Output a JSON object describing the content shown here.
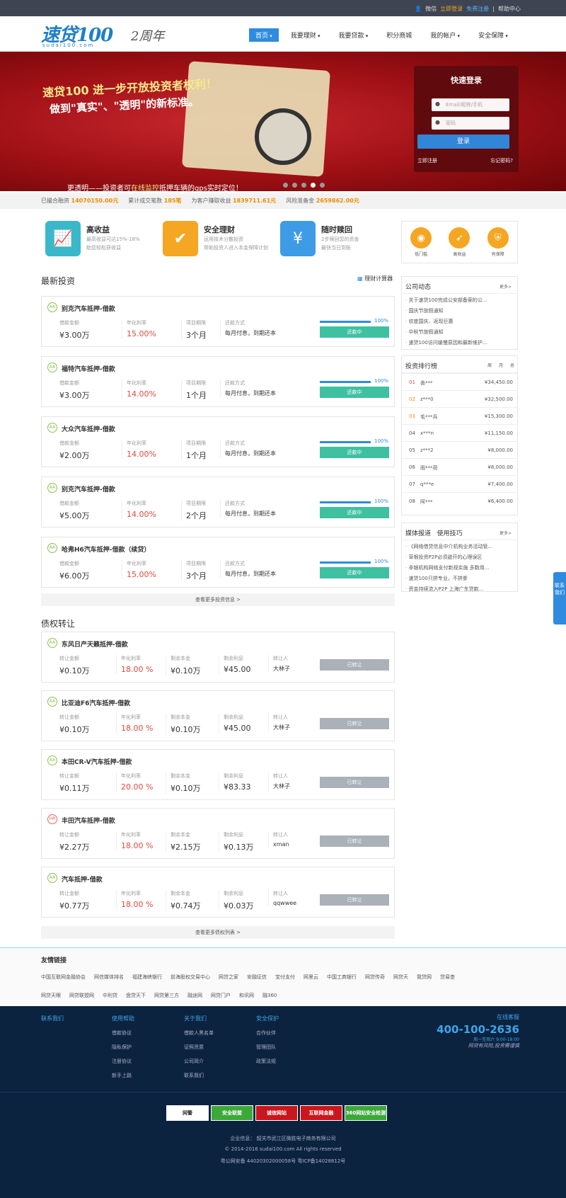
{
  "topbar": {
    "wechat": "微信",
    "login": "立即登录",
    "register": "免费注册",
    "help": "帮助中心"
  },
  "header": {
    "logo": "速贷100",
    "logo_sub": "sudai100.com",
    "anniversary": "2周年"
  },
  "nav": [
    {
      "label": "首页",
      "active": true
    },
    {
      "label": "我要理财"
    },
    {
      "label": "我要贷款"
    },
    {
      "label": "积分商城"
    },
    {
      "label": "我的帐户"
    },
    {
      "label": "安全保障"
    }
  ],
  "banner": {
    "headline1": "速贷100 进一步开放投资者权利！",
    "headline2": "做到\"真实\"、\"透明\"的新标准。",
    "bottom_a": "更透明——投资者可",
    "bottom_hl": "在线监控",
    "bottom_b": "抵押车辆的gps实时定位！"
  },
  "login_box": {
    "title": "快速登录",
    "email_placeholder": "Email/昵称/手机",
    "password_placeholder": "密码",
    "submit": "登录",
    "register": "立即注册",
    "forgot": "忘记密码?"
  },
  "stats": [
    {
      "label": "已撮合融资",
      "value": "14070150.00元"
    },
    {
      "label": "累计成交笔数",
      "value": "185笔"
    },
    {
      "label": "为客户赚取收益",
      "value": "1839711.61元"
    },
    {
      "label": "风险准备金",
      "value": "2659862.00元"
    }
  ],
  "features": [
    {
      "title": "高收益",
      "line1": "最高收益可达15%-18%",
      "line2": "助您轻松获收益"
    },
    {
      "title": "安全理财",
      "line1": "运用技术分散投资",
      "line2": "帮助投资人进入本金保障计划"
    },
    {
      "title": "随时赎回",
      "line1": "2步赎回您的资金",
      "line2": "最快当日到账"
    }
  ],
  "badges": [
    "低门槛",
    "高收益",
    "有保障"
  ],
  "invest": {
    "section_title": "最新投资",
    "calculator": "理财计算器",
    "labels": {
      "amount": "借款金额",
      "rate": "年化利率",
      "term": "项目期限",
      "method": "还款方式"
    },
    "items": [
      {
        "title": "别克汽车抵押-借款",
        "amount": "¥3.00万",
        "rate": "15.00%",
        "term": "3个月",
        "method": "每月付息，到期还本",
        "progress": 100,
        "progress_text": "100%",
        "status": "还款中"
      },
      {
        "title": "福特汽车抵押-借款",
        "amount": "¥3.00万",
        "rate": "14.00%",
        "term": "1个月",
        "method": "每月付息，到期还本",
        "progress": 100,
        "progress_text": "100%",
        "status": "还款中"
      },
      {
        "title": "大众汽车抵押-借款",
        "amount": "¥2.00万",
        "rate": "14.00%",
        "term": "1个月",
        "method": "每月付息，到期还本",
        "progress": 100,
        "progress_text": "100%",
        "status": "还款中"
      },
      {
        "title": "别克汽车抵押-借款",
        "amount": "¥5.00万",
        "rate": "14.00%",
        "term": "2个月",
        "method": "每月付息，到期还本",
        "progress": 100,
        "progress_text": "100%",
        "status": "还款中"
      },
      {
        "title": "哈弗H6汽车抵押-借款（续贷）",
        "amount": "¥6.00万",
        "rate": "15.00%",
        "term": "3个月",
        "method": "每月付息，到期还本",
        "progress": 100,
        "progress_text": "100%",
        "status": "还款中"
      }
    ],
    "more": "查看更多投资信息 >"
  },
  "transfer": {
    "section_title": "债权转让",
    "labels": {
      "amount": "转让金额",
      "rate": "年化利率",
      "principal": "剩余本金",
      "interest": "剩余利息",
      "person": "转让人"
    },
    "items": [
      {
        "badge": "AA",
        "title": "东风日产天籁抵押-借款",
        "amount": "¥0.10万",
        "rate": "18.00 %",
        "principal": "¥0.10万",
        "interest": "¥45.00",
        "person": "大林子",
        "status": "已转让"
      },
      {
        "badge": "AA",
        "title": "比亚迪F6汽车抵押-借款",
        "amount": "¥0.10万",
        "rate": "18.00 %",
        "principal": "¥0.10万",
        "interest": "¥45.00",
        "person": "大林子",
        "status": "已转让"
      },
      {
        "badge": "AA",
        "title": "本田CR-V汽车抵押-借款",
        "amount": "¥0.11万",
        "rate": "20.00 %",
        "principal": "¥0.10万",
        "interest": "¥83.33",
        "person": "大林子",
        "status": "已转让"
      },
      {
        "badge": "HR",
        "title": "丰田汽车抵押-借款",
        "amount": "¥2.27万",
        "rate": "18.00 %",
        "principal": "¥2.15万",
        "interest": "¥0.13万",
        "person": "xman",
        "status": "已转让"
      },
      {
        "badge": "AA",
        "title": "汽车抵押-借款",
        "amount": "¥0.77万",
        "rate": "18.00 %",
        "principal": "¥0.74万",
        "interest": "¥0.03万",
        "person": "qqwwee",
        "status": "已转让"
      }
    ],
    "more": "查看更多债权列表 >"
  },
  "news": {
    "title": "公司动态",
    "more": "更多>",
    "items": [
      "关于速贷100完成公安部备案的公...",
      "国庆节放假通知",
      "欢度国庆、返现巨惠",
      "中秋节放假通知",
      "速贷100访问缓慢原因和最新维护..."
    ]
  },
  "ranking": {
    "title": "投资排行榜",
    "tabs": [
      "周",
      "月",
      "总"
    ],
    "rows": [
      {
        "n": "01",
        "user": "善***",
        "amount": "¥34,450.00"
      },
      {
        "n": "02",
        "user": "z***0",
        "amount": "¥32,500.00"
      },
      {
        "n": "03",
        "user": "毛***兵",
        "amount": "¥15,300.00"
      },
      {
        "n": "04",
        "user": "x***n",
        "amount": "¥11,150.00"
      },
      {
        "n": "05",
        "user": "z***2",
        "amount": "¥8,000.00"
      },
      {
        "n": "06",
        "user": "雨***荷",
        "amount": "¥8,000.00"
      },
      {
        "n": "07",
        "user": "q***e",
        "amount": "¥7,400.00"
      },
      {
        "n": "08",
        "user": "阿***",
        "amount": "¥6,400.00"
      }
    ]
  },
  "media": {
    "tab1": "媒体报道",
    "tab2": "使用技巧",
    "more": "更多>",
    "items": [
      "《网络借贷信息中介机构业务活动管...",
      "草根投资P2P必须避开的心理误区",
      "非银机构网络支付新规实施 多数用...",
      "速贷100只拼专业，不拼爹",
      "资金持续流入P2P 上海广东贷款..."
    ]
  },
  "float_tab": "联系我们",
  "friend_links": {
    "title": "友情链接",
    "row1": [
      "中国互联网金融协会",
      "网信媒体排名",
      "福建海峡银行",
      "前海股权交易中心",
      "网贷之家",
      "安融征信",
      "宝付支付",
      "网里云",
      "中国工商银行",
      "网贷传奇",
      "网贷天",
      "我贷网",
      "贷易查"
    ],
    "row2": [
      "网贷天眼",
      "网贷联盟网",
      "中利贷",
      "盘贷天下",
      "网贷第三方",
      "融途网",
      "网贷门户",
      "和讯网",
      "融360"
    ]
  },
  "footer": {
    "cols": [
      {
        "title": "联系我们",
        "items": []
      },
      {
        "title": "使用帮助",
        "items": [
          "借款协议",
          "隐私保护",
          "注册协议",
          "新手上路"
        ]
      },
      {
        "title": "关于我们",
        "items": [
          "借款人黑名单",
          "证照资质",
          "公司简介",
          "联系我们"
        ]
      },
      {
        "title": "安全保护",
        "items": [
          "合作伙伴",
          "管理团队",
          "政策法规"
        ]
      }
    ],
    "service": "在线客服",
    "phone": "400-100-2636",
    "hours": "周一至周六 9:00-18:00",
    "slogan": "网贷有风险,投资需谨慎",
    "certs": [
      "网警",
      "安全联盟",
      "诚信网站",
      "互联网金融",
      "360网站安全检测"
    ],
    "company": "企业信息：  韶关市武江区微胜电子商务有限公司",
    "copyright": "© 2014-2016 sudai100.com All rights reserved",
    "icp": "粤公网安备 44020302000058号    粤ICP备14028812号"
  }
}
